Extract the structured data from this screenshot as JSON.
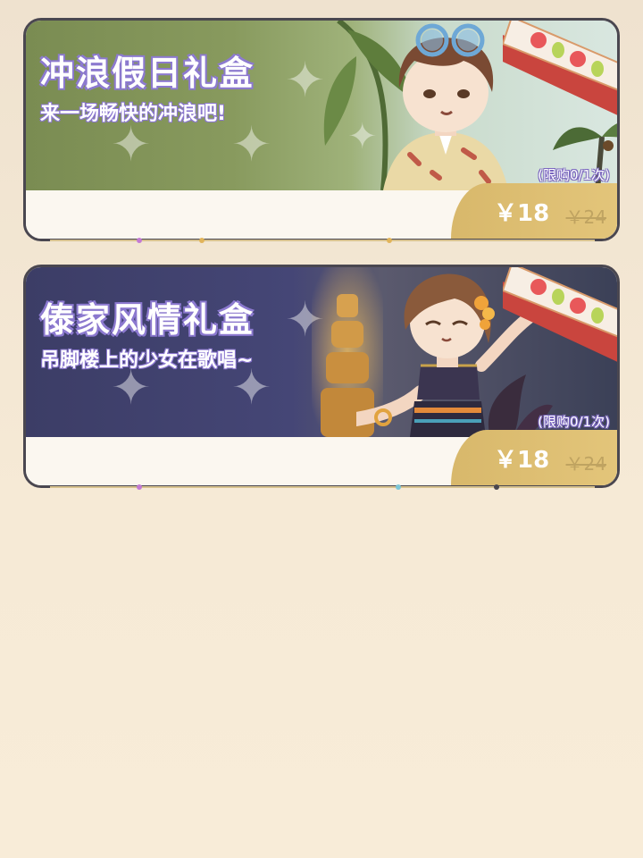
{
  "cards": [
    {
      "title": "冲浪假日礼盒",
      "subtitle": "来一场畅快的冲浪吧!",
      "limit": "(限购0/1次)",
      "price": "￥18",
      "old_price": "￥24"
    },
    {
      "title": "傣家风情礼盒",
      "subtitle": "吊脚楼上的少女在歌唱~",
      "limit": "(限购0/1次)",
      "price": "￥18",
      "old_price": "￥24"
    }
  ],
  "colors": {
    "card_border": "#4a4750",
    "price_tab": "#d8b86b",
    "title_outline": "#8d7bd1",
    "banner_1": "#7a8c52",
    "banner_2": "#3c3d66"
  },
  "icons": [
    "sparkle-icon",
    "apple-icon",
    "pear-icon",
    "ribbon-icon"
  ]
}
